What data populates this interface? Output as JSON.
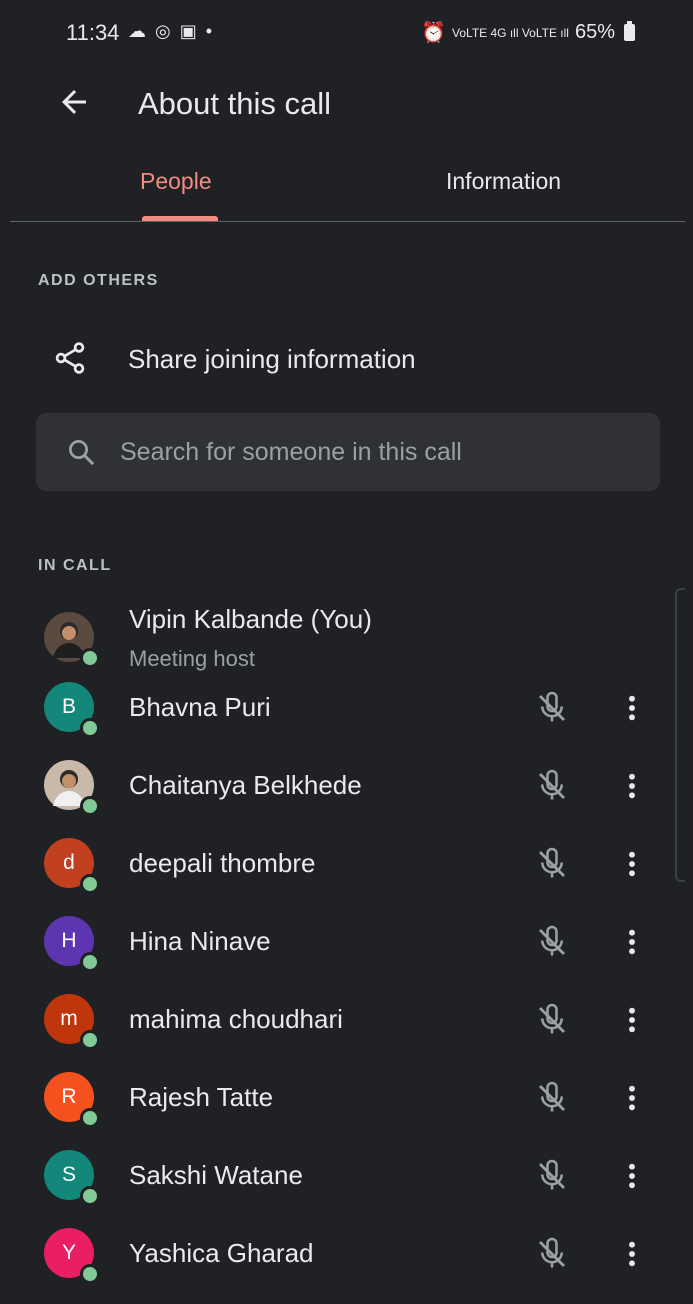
{
  "status_bar": {
    "time": "11:34",
    "notification_icons": "☁ ◎ ▣ •",
    "alarm": "⏰",
    "signal": "VoLTE 4G ıll VoLTE ıll",
    "battery": "65%"
  },
  "header": {
    "back_icon": "arrow-back-icon",
    "title": "About this call"
  },
  "tabs": [
    {
      "label": "People",
      "active": true
    },
    {
      "label": "Information",
      "active": false
    }
  ],
  "add_others": {
    "section_label": "ADD OTHERS",
    "share_label": "Share joining information",
    "share_icon": "share-icon"
  },
  "search": {
    "placeholder": "Search for someone in this call",
    "value": ""
  },
  "in_call": {
    "section_label": "IN CALL",
    "participants": [
      {
        "name": "Vipin Kalbande (You)",
        "role": "Meeting host",
        "initial": "",
        "photo": true,
        "color": "#5b4a3f"
      },
      {
        "name": "Bhavna Puri",
        "initial": "B",
        "color": "#12877a"
      },
      {
        "name": "Chaitanya Belkhede",
        "initial": "",
        "photo": true,
        "color": "#c9b9a8"
      },
      {
        "name": "deepali thombre",
        "initial": "d",
        "color": "#c1401f"
      },
      {
        "name": "Hina Ninave",
        "initial": "H",
        "color": "#5e35b1"
      },
      {
        "name": "mahima choudhari",
        "initial": "m",
        "color": "#bf360c"
      },
      {
        "name": "Rajesh Tatte",
        "initial": "R",
        "color": "#f4511e"
      },
      {
        "name": "Sakshi Watane",
        "initial": "S",
        "color": "#12877a"
      },
      {
        "name": "Yashica Gharad",
        "initial": "Y",
        "color": "#e91e63"
      }
    ]
  },
  "colors": {
    "background": "#202124",
    "accent": "#f28b82",
    "presence": "#81c995",
    "search_bg": "#303134"
  }
}
